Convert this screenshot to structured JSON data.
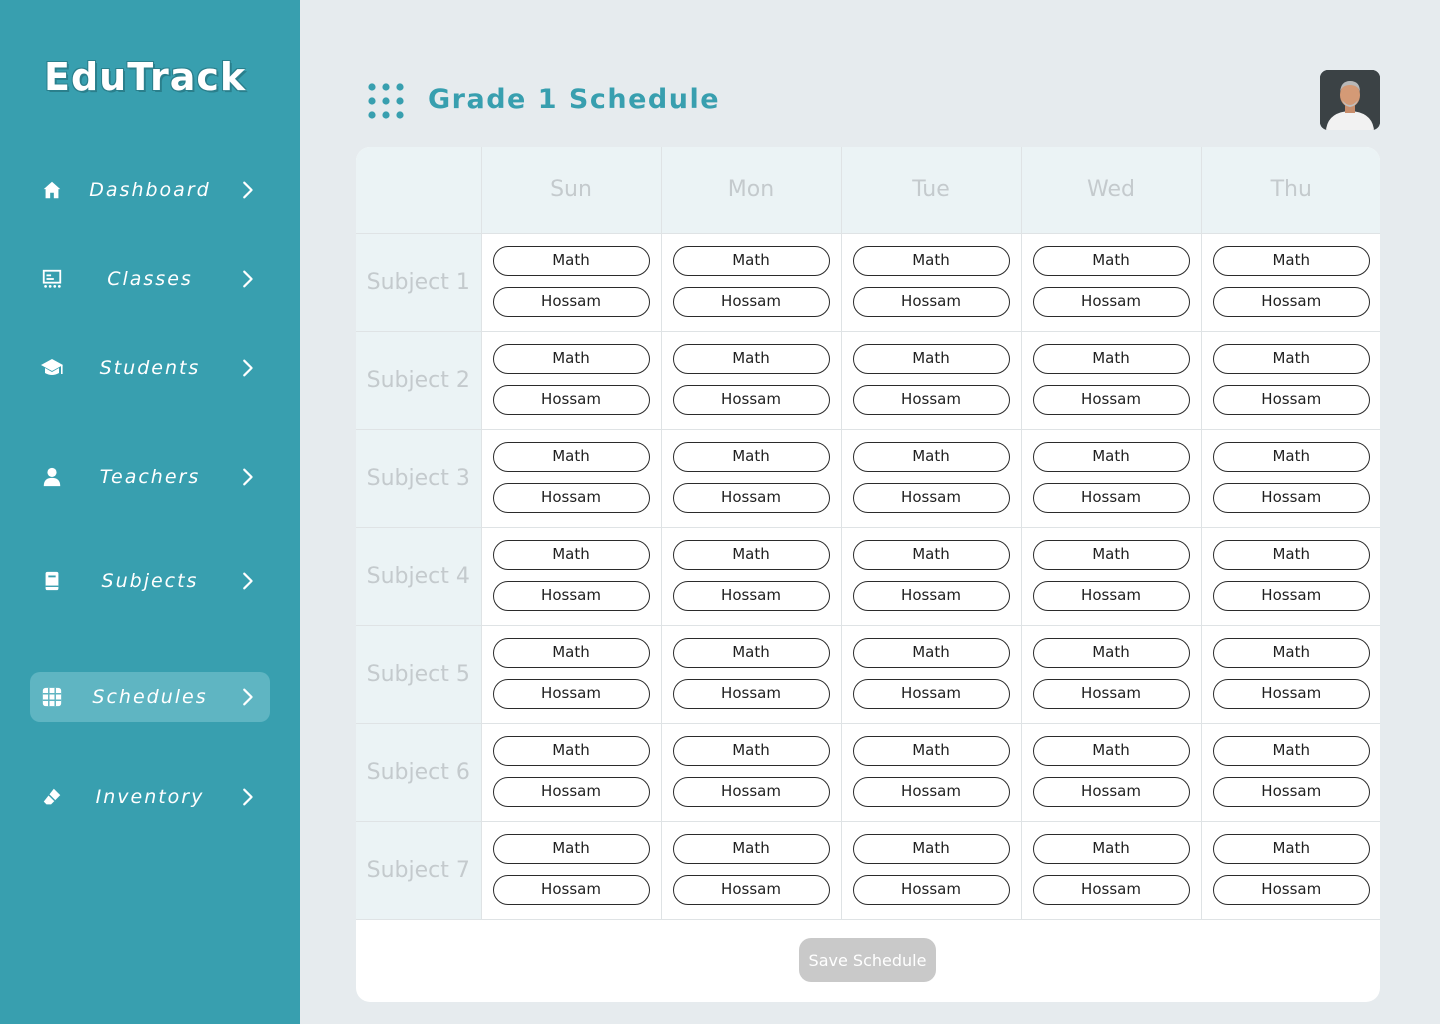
{
  "app": {
    "name": "EduTrack"
  },
  "sidebar": {
    "items": [
      {
        "label": "Dashboard",
        "icon": "home-icon"
      },
      {
        "label": "Classes",
        "icon": "classroom-icon"
      },
      {
        "label": "Students",
        "icon": "graduation-cap-icon"
      },
      {
        "label": "Teachers",
        "icon": "person-icon"
      },
      {
        "label": "Subjects",
        "icon": "book-icon"
      },
      {
        "label": "Schedules",
        "icon": "grid-icon",
        "active": true
      },
      {
        "label": "Inventory",
        "icon": "eraser-icon"
      }
    ]
  },
  "header": {
    "title": "Grade 1 Schedule",
    "menu_icon": "dots-grid-icon",
    "avatar": "user-avatar"
  },
  "schedule": {
    "days": [
      "Sun",
      "Mon",
      "Tue",
      "Wed",
      "Thu"
    ],
    "subjects": [
      "Subject 1",
      "Subject 2",
      "Subject 3",
      "Subject 4",
      "Subject 5",
      "Subject 6",
      "Subject 7"
    ],
    "slot_subject": "Math",
    "slot_teacher": "Hossam"
  },
  "actions": {
    "save_label": "Save Schedule"
  },
  "colors": {
    "accent": "#389faf",
    "sidebar_active": "#5fb5c2",
    "background": "#e6ebee",
    "header_cell": "#ebf3f5"
  }
}
